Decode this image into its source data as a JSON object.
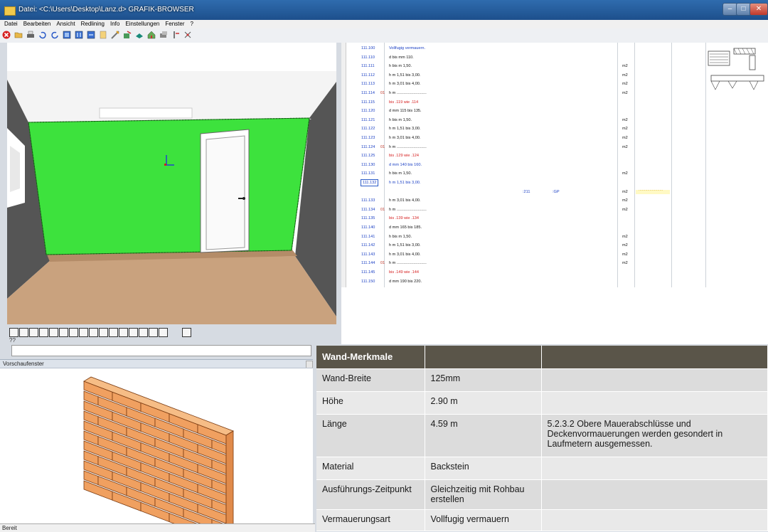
{
  "window": {
    "title": "Datei: <C:\\Users\\Desktop\\Lanz.d>   GRAFIK-BROWSER"
  },
  "menu": [
    "Datei",
    "Bearbeiten",
    "Ansicht",
    "Redlining",
    "Info",
    "Einstellungen",
    "Fenster",
    "?"
  ],
  "viewport": {
    "status": "??"
  },
  "preview": {
    "title": "Vorschaufenster"
  },
  "statusbar": {
    "text": "Bereit"
  },
  "list_rows": [
    {
      "code": "111.100",
      "marker": "",
      "desc": "Vollfugig vermauern.",
      "unit": "",
      "color": "#1a3fc4"
    },
    {
      "code": "111.110",
      "marker": "",
      "desc": "d bis mm 110.",
      "unit": "",
      "color": "#111"
    },
    {
      "code": "111.111",
      "marker": "",
      "desc": "h bis m 1,50.",
      "unit": "m2",
      "color": "#111"
    },
    {
      "code": "111.112",
      "marker": "",
      "desc": "h m 1,51 bis 3,00.",
      "unit": "m2",
      "color": "#111"
    },
    {
      "code": "111.113",
      "marker": "",
      "desc": "h m 3,01 bis 4,00.",
      "unit": "m2",
      "color": "#111"
    },
    {
      "code": "111.114",
      "marker": "01",
      "desc": "h m ...........................",
      "unit": "m2",
      "color": "#111"
    },
    {
      "code": "111.115",
      "marker": "",
      "desc": "bis .119 wie .114",
      "unit": "",
      "color": "#d62020"
    },
    {
      "code": "111.120",
      "marker": "",
      "desc": "d mm 115 bis 135.",
      "unit": "",
      "color": "#111"
    },
    {
      "code": "111.121",
      "marker": "",
      "desc": "h bis m 1,50.",
      "unit": "m2",
      "color": "#111"
    },
    {
      "code": "111.122",
      "marker": "",
      "desc": "h m 1,51 bis 3,00.",
      "unit": "m2",
      "color": "#111"
    },
    {
      "code": "111.123",
      "marker": "",
      "desc": "h m 3,01 bis 4,00.",
      "unit": "m2",
      "color": "#111"
    },
    {
      "code": "111.124",
      "marker": "01",
      "desc": "h m ...........................",
      "unit": "m2",
      "color": "#111"
    },
    {
      "code": "111.125",
      "marker": "",
      "desc": "bis .129 wie .124",
      "unit": "",
      "color": "#d62020"
    },
    {
      "code": "111.130",
      "marker": "",
      "desc": "d mm 140 bis 160.",
      "unit": "",
      "color": "#1a3fc4"
    },
    {
      "code": "111.131",
      "marker": "",
      "desc": "h bis m 1,50.",
      "unit": "m2",
      "color": "#111"
    },
    {
      "code": "111.132",
      "marker": "",
      "desc": "h m 1,51 bis 3,00.",
      "unit": "",
      "color": "#1a3fc4"
    },
    {
      "code": "",
      "marker": "",
      "desc": "",
      "unit": "m2",
      "color": "#1a3fc4",
      "extra1": ":211",
      "extra2": ":GP"
    },
    {
      "code": "111.133",
      "marker": "",
      "desc": "h m 3,01 bis 4,00.",
      "unit": "m2",
      "color": "#111"
    },
    {
      "code": "111.134",
      "marker": "01",
      "desc": "h m ...........................",
      "unit": "m2",
      "color": "#111"
    },
    {
      "code": "111.135",
      "marker": "",
      "desc": "bis .139 wie .134",
      "unit": "",
      "color": "#d62020"
    },
    {
      "code": "111.140",
      "marker": "",
      "desc": "d mm 165 bis 185.",
      "unit": "",
      "color": "#111"
    },
    {
      "code": "111.141",
      "marker": "",
      "desc": "h bis m 1,50.",
      "unit": "m2",
      "color": "#111"
    },
    {
      "code": "111.142",
      "marker": "",
      "desc": "h m 1,51 bis 3,00.",
      "unit": "m2",
      "color": "#111"
    },
    {
      "code": "111.143",
      "marker": "",
      "desc": "h m 3,01 bis 4,00.",
      "unit": "m2",
      "color": "#111"
    },
    {
      "code": "111.144",
      "marker": "01",
      "desc": "h m ...........................",
      "unit": "m2",
      "color": "#111"
    },
    {
      "code": "111.145",
      "marker": "",
      "desc": "bis .149 wie .144",
      "unit": "",
      "color": "#d62020"
    },
    {
      "code": "111.150",
      "marker": "",
      "desc": "d mm 190 bis 220.",
      "unit": "",
      "color": "#111"
    }
  ],
  "selected_code": "111.132",
  "ellipsis_marker": "......................",
  "properties": {
    "header": "Wand-Merkmale",
    "rows": [
      {
        "label": "Wand-Breite",
        "value": "125mm",
        "note": ""
      },
      {
        "label": "Höhe",
        "value": "2.90 m",
        "note": ""
      },
      {
        "label": "Länge",
        "value": "4.59 m",
        "note": "5.2.3.2 Obere Mauerabschlüsse und Deckenvormauerungen werden gesondert in Laufmetern ausgemessen."
      },
      {
        "label": "Material",
        "value": "Backstein",
        "note": ""
      },
      {
        "label": "Ausführungs-Zeitpunkt",
        "value": "Gleichzeitig mit Rohbau erstellen",
        "note": ""
      },
      {
        "label": "Vermauerungsart",
        "value": "Vollfugig vermauern",
        "note": ""
      }
    ]
  },
  "colors": {
    "wall": "#3de23d",
    "floor": "#c9a27e",
    "header": "#5a5549",
    "code_blue": "#1a3fc4",
    "code_red": "#d62020"
  }
}
